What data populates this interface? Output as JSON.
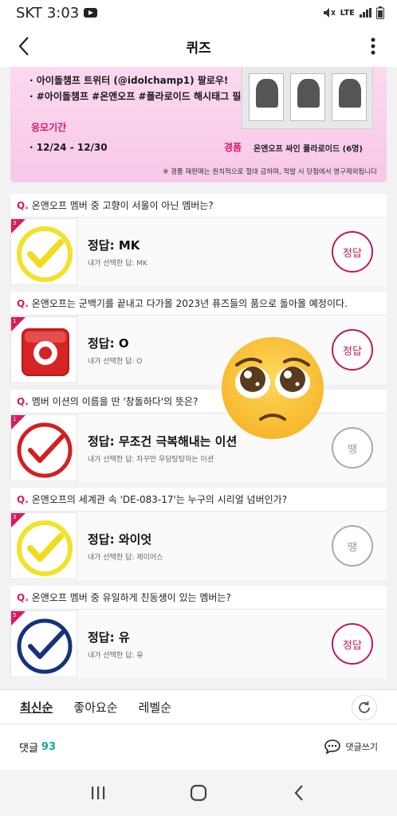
{
  "status": {
    "carrier": "SKT",
    "time": "3:03",
    "network": "LTE"
  },
  "appbar": {
    "title": "퀴즈"
  },
  "banner": {
    "line1": "· 아이돌챔프 트위터 (@idolchamp1) 팔로우!",
    "line2": "· #아이돌챔프 #온앤오프 #폴라로이드 해시태그 필수!",
    "period_label": "응모기간",
    "period": "· 12/24 - 12/30",
    "prize_label": "경품",
    "prize": "온앤오프 싸인 폴라로이드 (6명)",
    "notice": "※ 경품 재판매는 원칙적으로 절대 금하며, 적발 시 당첨에서 영구제외됩니다"
  },
  "quizzes": [
    {
      "q": "Q.",
      "question": "온앤오프 멤버 중 고향이 서울이 아닌 멤버는?",
      "answer": "정답: MK",
      "chosen": "내가 선택한 답: MK",
      "result": "정답",
      "correct": true,
      "icon": "yellow-check-icon",
      "num": "3"
    },
    {
      "q": "Q.",
      "question": "온앤오프는 군백기를 끝내고 다가올 2023년 퓨즈들의 품으로 돌아올 예정이다.",
      "answer": "정답: O",
      "chosen": "내가 선택한 답: O",
      "result": "정답",
      "correct": true,
      "icon": "red-o-button-icon",
      "num": "1"
    },
    {
      "q": "Q.",
      "question": "멤버 이션의 이름을 딴 '창돌하다'의 뜻은?",
      "answer": "정답: 무조건 극복해내는 이션",
      "chosen": "내가 선택한 답: 자꾸만 우당탕탕하는 이션",
      "result": "땡",
      "correct": false,
      "icon": "red-check-icon",
      "num": "1"
    },
    {
      "q": "Q.",
      "question": "온앤오프의 세계관 속 'DE-083-17'는 누구의 시리얼 넘버인가?",
      "answer": "정답: 와이엇",
      "chosen": "내가 선택한 답: 제이어스",
      "result": "땡",
      "correct": false,
      "icon": "yellow-check-icon",
      "num": "3"
    },
    {
      "q": "Q.",
      "question": "온앤오프 멤버 중 유일하게 친동생이 있는 멤버는?",
      "answer": "정답: 유",
      "chosen": "내가 선택한 답: 유",
      "result": "정답",
      "correct": true,
      "icon": "blue-check-icon",
      "num": "5"
    }
  ],
  "sort": {
    "latest": "최신순",
    "likes": "좋아요순",
    "level": "레벨순"
  },
  "comments": {
    "label": "댓글",
    "count": "93",
    "write": "댓글쓰기"
  },
  "colors": {
    "accent": "#c2185b",
    "teal": "#13a8a0"
  }
}
